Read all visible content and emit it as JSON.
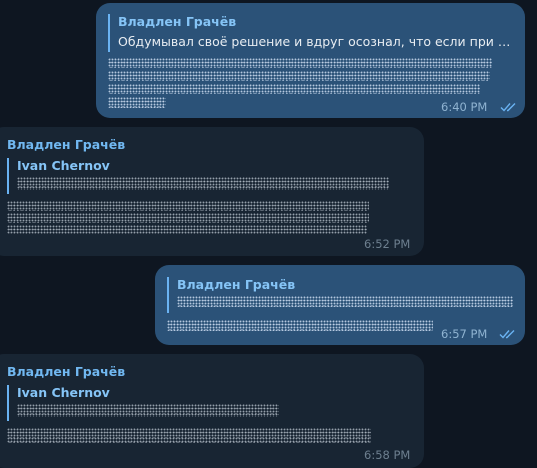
{
  "messages": [
    {
      "direction": "outgoing",
      "reply_author": "Владлен Грачёв",
      "reply_preview": "Обдумывал своё решение и вдруг осознал, что если при ре...",
      "time": "6:40 PM",
      "status_icon": "double-check-icon"
    },
    {
      "direction": "incoming",
      "sender": "Владлен Грачёв",
      "reply_author": "Ivan Chernov",
      "time": "6:52 PM"
    },
    {
      "direction": "outgoing",
      "reply_author": "Владлен Грачёв",
      "time": "6:57 PM",
      "status_icon": "double-check-icon"
    },
    {
      "direction": "incoming",
      "sender": "Владлен Грачёв",
      "reply_author": "Ivan Chernov",
      "time": "6:58 PM"
    }
  ],
  "colors": {
    "background": "#0e1621",
    "outgoing_bubble": "#2b5278",
    "incoming_bubble": "#182533",
    "accent": "#6ab3f3"
  }
}
